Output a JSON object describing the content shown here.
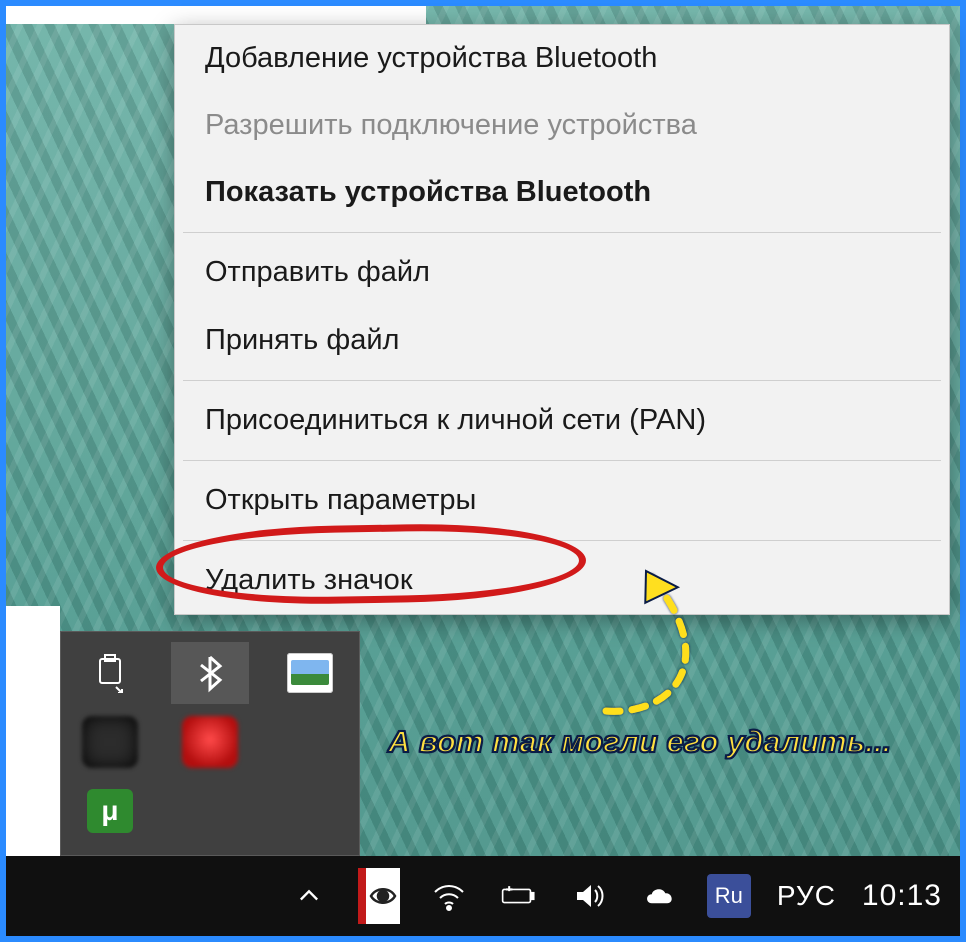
{
  "context_menu": {
    "items": [
      {
        "label": "Добавление устройства Bluetooth",
        "disabled": false,
        "bold": false
      },
      {
        "label": "Разрешить подключение устройства",
        "disabled": true,
        "bold": false
      },
      {
        "label": "Показать устройства Bluetooth",
        "disabled": false,
        "bold": true
      },
      {
        "sep": true
      },
      {
        "label": "Отправить файл",
        "disabled": false,
        "bold": false
      },
      {
        "label": "Принять файл",
        "disabled": false,
        "bold": false
      },
      {
        "sep": true
      },
      {
        "label": "Присоединиться к личной сети (PAN)",
        "disabled": false,
        "bold": false
      },
      {
        "sep": true
      },
      {
        "label": "Открыть параметры",
        "disabled": false,
        "bold": false
      },
      {
        "sep": true
      },
      {
        "label": "Удалить значок",
        "disabled": false,
        "bold": false
      }
    ]
  },
  "annotation": {
    "text": "А вот так могли его удалить...",
    "highlight_color": "#d11a1a",
    "arrow_color": "#ffdf1f"
  },
  "tray_popup": {
    "icons": {
      "usb": "usb-eject-icon",
      "bluetooth": "bluetooth-icon",
      "photos": "photos-icon",
      "unknown_dark": "app-icon",
      "unknown_red": "recorder-icon",
      "utorrent_glyph": "μ"
    },
    "selected": "bluetooth"
  },
  "taskbar": {
    "caret": "chevron-up-icon",
    "eye": "eye-app-icon",
    "wifi": "wifi-icon",
    "battery": "battery-charging-icon",
    "volume": "volume-icon",
    "onedrive": "onedrive-icon",
    "ru_badge": "Ru",
    "lang": "РУС",
    "clock": "10:13"
  }
}
